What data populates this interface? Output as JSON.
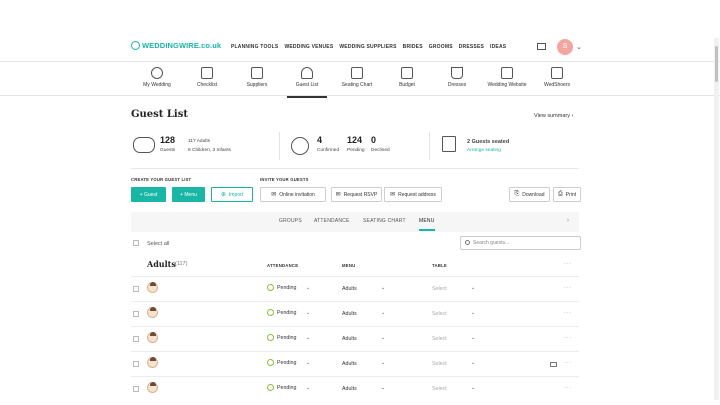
{
  "brand": {
    "name": "WEDDINGWIRE.co.uk",
    "accent": "#19b5a5"
  },
  "nav": {
    "links": [
      "PLANNING TOOLS",
      "WEDDING VENUES",
      "WEDDING SUPPLIERS",
      "BRIDES",
      "GROOMS",
      "DRESSES",
      "IDEAS"
    ],
    "avatar_initial": "S"
  },
  "tools": [
    {
      "label": "My Wedding",
      "icon": "rings-icon"
    },
    {
      "label": "Checklist",
      "icon": "checklist-icon"
    },
    {
      "label": "Suppliers",
      "icon": "suppliers-icon"
    },
    {
      "label": "Guest List",
      "icon": "guests-icon"
    },
    {
      "label": "Seating Chart",
      "icon": "seating-icon"
    },
    {
      "label": "Budget",
      "icon": "calculator-icon"
    },
    {
      "label": "Dresses",
      "icon": "dress-icon"
    },
    {
      "label": "Wedding Website",
      "icon": "website-icon"
    },
    {
      "label": "WedShoers",
      "icon": "photo-icon"
    }
  ],
  "page": {
    "title": "Guest List",
    "view_summary": "View summary ›"
  },
  "stats": {
    "guests_total": "128",
    "guests_label": "Guests",
    "adults": "117 Adults",
    "children": "8 Children, 3 Infants",
    "confirmed": "4",
    "confirmed_label": "Confirmed",
    "pending": "124",
    "pending_label": "Pending",
    "declined": "0",
    "declined_label": "Declined",
    "seated": "2 Guests seated",
    "arrange": "Arrange seating"
  },
  "actions": {
    "create_label": "CREATE YOUR GUEST LIST",
    "invite_label": "INVITE YOUR GUESTS",
    "guest_btn": "+ Guest",
    "menu_btn": "+ Menu",
    "import_btn": "Import",
    "online_inv": "Online invitation",
    "request_rsvp": "Request RSVP",
    "request_addr": "Request address",
    "download": "Download",
    "print": "Print"
  },
  "filters": [
    "GROUPS",
    "ATTENDANCE",
    "SEATING CHART",
    "MENU"
  ],
  "list": {
    "select_all": "Select all",
    "search_placeholder": "Search guests...",
    "group_title": "Adults",
    "group_count": "(117)",
    "columns": {
      "attendance": "ATTENDANCE",
      "menu": "MENU",
      "table": "TABLE"
    },
    "rows": [
      {
        "attendance": "Pending",
        "menu": "Adults",
        "table": "Select"
      },
      {
        "attendance": "Pending",
        "menu": "Adults",
        "table": "Select"
      },
      {
        "attendance": "Pending",
        "menu": "Adults",
        "table": "Select"
      },
      {
        "attendance": "Pending",
        "menu": "Adults",
        "table": "Select"
      },
      {
        "attendance": "Pending",
        "menu": "Adults",
        "table": "Select"
      }
    ]
  }
}
